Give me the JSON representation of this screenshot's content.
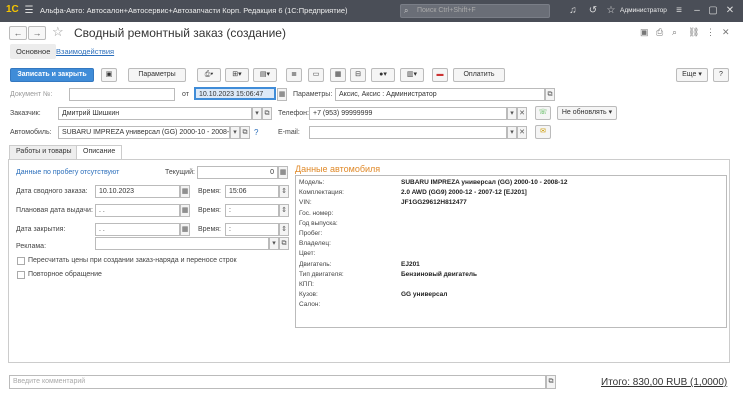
{
  "window": {
    "logo": "1С",
    "title": "Альфа-Авто: Автосалон+Автосервис+Автозапчасти Корп. Редакция 6  (1С:Предприятие)",
    "search_placeholder": "Поиск Ctrl+Shift+F",
    "user": "Администратор"
  },
  "header": {
    "page_title": "Сводный ремонтный заказ (создание)",
    "tab_main": "Основное",
    "tab_links": "Взаимодействия"
  },
  "toolbar": {
    "save_close": "Записать и закрыть",
    "params": "Параметры",
    "pay": "Оплатить",
    "more": "Еще",
    "help": "?"
  },
  "form": {
    "doc_label": "Документ №:",
    "doc_placeholder": "",
    "from_label": "от",
    "date_value": "10.10.2023 15:06:47",
    "params_label": "Параметры:",
    "params_value": "Аксис, Аксис : Администратор",
    "customer_label": "Заказчик:",
    "customer_value": "Дмитрий Шишкин",
    "phone_label": "Телефон:",
    "phone_value": "+7 (953) 99999999",
    "no_update": "Не обновлять",
    "car_label": "Автомобиль:",
    "car_value": "SUBARU IMPREZA универсал (GG) 2000-10 - 2008-",
    "email_label": "E-mail:",
    "email_value": ""
  },
  "section_tabs": {
    "works": "Работы и товары",
    "desc": "Описание"
  },
  "desc": {
    "mileage_note": "Данные по пробегу отсутствуют",
    "current_label": "Текущий:",
    "current_value": "0",
    "summary_date_label": "Дата сводного заказа:",
    "summary_date": "10.10.2023",
    "time_label": "Время:",
    "time_value": "15:06",
    "planned_label": "Плановая дата выдачи:",
    "planned_value": ". .",
    "time2_label": "Время:",
    "time2_value": ":",
    "close_label": "Дата закрытия:",
    "close_value": ". .",
    "time3_label": "Время:",
    "time3_value": ":",
    "ad_label": "Реклама:",
    "ad_value": "",
    "chk1": "Пересчитать цены при создании заказ-наряда и переносе строк",
    "chk2": "Повторное обращение"
  },
  "car_data": {
    "title": "Данные автомобиля",
    "rows": [
      {
        "k": "Модель:",
        "v": "SUBARU IMPREZA универсал (GG) 2000-10 - 2008-12"
      },
      {
        "k": "Комплектация:",
        "v": "2.0 AWD (GG9) 2000-12 - 2007-12 [EJ201]"
      },
      {
        "k": "VIN:",
        "v": "JF1GG29612H812477"
      },
      {
        "k": "Гос. номер:",
        "v": ""
      },
      {
        "k": "Год выпуска:",
        "v": ""
      },
      {
        "k": "Пробег:",
        "v": ""
      },
      {
        "k": "Владелец:",
        "v": ""
      },
      {
        "k": "Цвет:",
        "v": ""
      },
      {
        "k": "Двигатель:",
        "v": "EJ201"
      },
      {
        "k": "Тип двигателя:",
        "v": "Бензиновый двигатель"
      },
      {
        "k": "КПП:",
        "v": ""
      },
      {
        "k": "Кузов:",
        "v": "GG универсал"
      },
      {
        "k": "Салон:",
        "v": ""
      }
    ]
  },
  "footer": {
    "comment_placeholder": "Введите комментарий",
    "total": "Итого: 830,00 RUB (1,0000)"
  },
  "colors": {
    "accent": "#3f8cd8",
    "titlebar": "#4a4e57",
    "orange": "#e08a2a"
  }
}
